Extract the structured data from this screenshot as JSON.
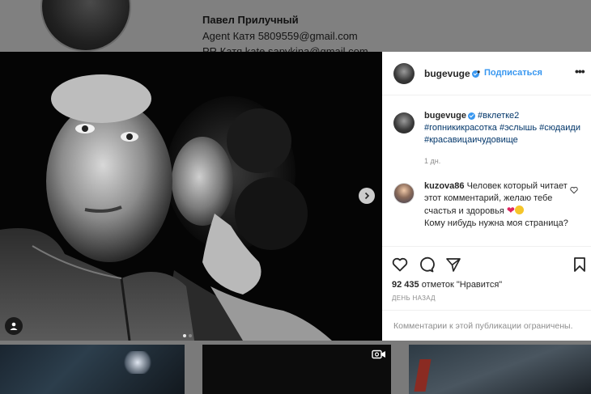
{
  "profile_bg": {
    "name": "Павел Прилучный",
    "bio_line1": "Agent Катя 5809559@gmail.com",
    "bio_line2": "PR Катя kate.sapykina@gmail.com"
  },
  "post": {
    "username": "bugevuge",
    "follow_label": "Подписаться",
    "separator": "•",
    "more_label": "•••",
    "caption_hashtags": "#вклетке2 #гопникикрасотка #эслышь #сюдаиди #красавицаичудовище",
    "caption_time": "1 дн.",
    "likes_count": "92 435",
    "likes_suffix": "отметок \"Нравится\"",
    "post_time": "ДЕНЬ НАЗАД",
    "comments_restricted": "Комментарии к этой публикации ограничены."
  },
  "comment": {
    "username": "kuzova86",
    "text_line1": "Человек который читает этот комментарий, желаю тебе счастья и здоровья",
    "text_line2": "Кому нибудь нужна моя страница?"
  },
  "carousel": {
    "count": 2,
    "active": 1
  },
  "colors": {
    "accent": "#3897f0",
    "hashtag": "#003569",
    "muted": "#8e8e8e",
    "text": "#262626"
  },
  "icons": [
    "heart-icon",
    "comment-icon",
    "share-icon",
    "bookmark-icon",
    "chevron-right-icon",
    "user-tag-icon",
    "video-icon"
  ]
}
